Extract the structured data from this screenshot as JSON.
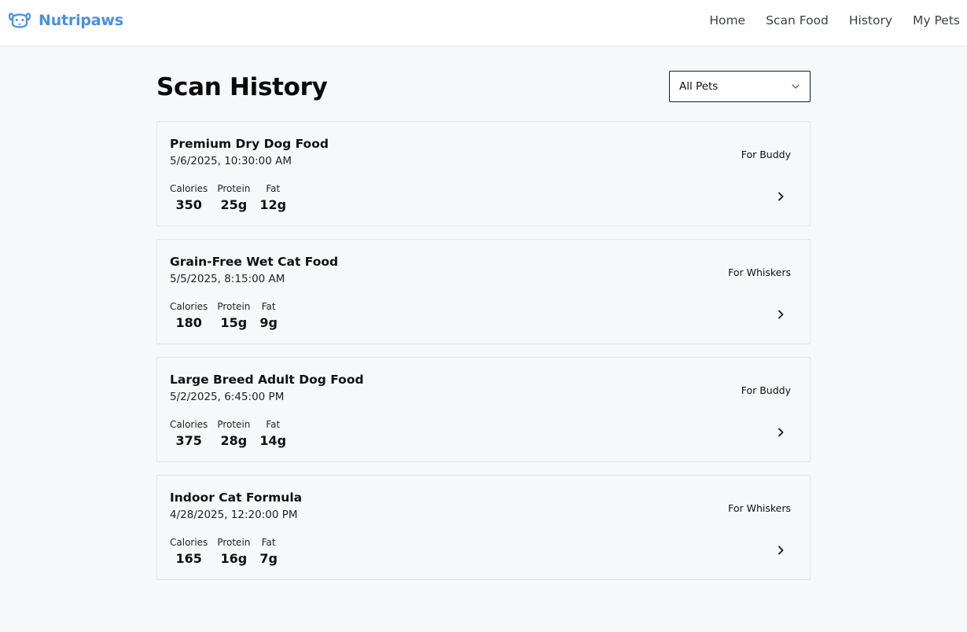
{
  "app": {
    "name": "Nutripaws",
    "logo_icon": "dog-face-icon",
    "brand_color": "#4a8fe0"
  },
  "nav": {
    "items": [
      {
        "label": "Home"
      },
      {
        "label": "Scan Food"
      },
      {
        "label": "History"
      },
      {
        "label": "My Pets"
      }
    ]
  },
  "page": {
    "title": "Scan History"
  },
  "filter": {
    "selected": "All Pets",
    "icon": "chevron-down-icon"
  },
  "scans": [
    {
      "name": "Premium Dry Dog Food",
      "date": "5/6/2025, 10:30:00 AM",
      "pet": "For Buddy",
      "nutrients": [
        {
          "label": "Calories",
          "value": "350"
        },
        {
          "label": "Protein",
          "value": "25g"
        },
        {
          "label": "Fat",
          "value": "12g"
        }
      ]
    },
    {
      "name": "Grain-Free Wet Cat Food",
      "date": "5/5/2025, 8:15:00 AM",
      "pet": "For Whiskers",
      "nutrients": [
        {
          "label": "Calories",
          "value": "180"
        },
        {
          "label": "Protein",
          "value": "15g"
        },
        {
          "label": "Fat",
          "value": "9g"
        }
      ]
    },
    {
      "name": "Large Breed Adult Dog Food",
      "date": "5/2/2025, 6:45:00 PM",
      "pet": "For Buddy",
      "nutrients": [
        {
          "label": "Calories",
          "value": "375"
        },
        {
          "label": "Protein",
          "value": "28g"
        },
        {
          "label": "Fat",
          "value": "14g"
        }
      ]
    },
    {
      "name": "Indoor Cat Formula",
      "date": "4/28/2025, 12:20:00 PM",
      "pet": "For Whiskers",
      "nutrients": [
        {
          "label": "Calories",
          "value": "165"
        },
        {
          "label": "Protein",
          "value": "16g"
        },
        {
          "label": "Fat",
          "value": "7g"
        }
      ]
    }
  ]
}
